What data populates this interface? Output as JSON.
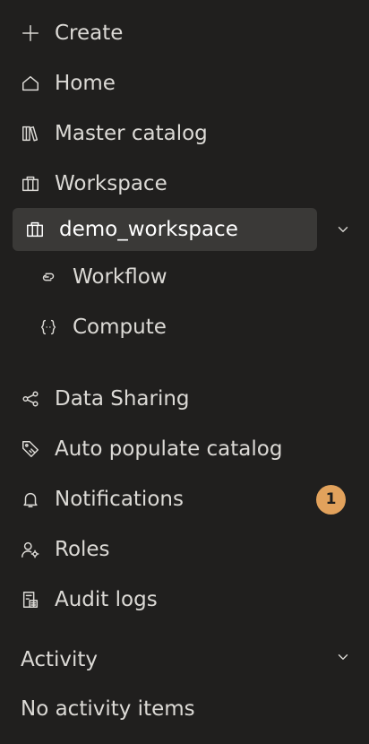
{
  "nav": {
    "create": "Create",
    "home": "Home",
    "master_catalog": "Master catalog",
    "workspace": "Workspace",
    "demo_workspace": "demo_workspace",
    "workflow": "Workflow",
    "compute": "Compute",
    "data_sharing": "Data Sharing",
    "auto_populate_catalog": "Auto populate catalog",
    "notifications": "Notifications",
    "notifications_count": "1",
    "roles": "Roles",
    "audit_logs": "Audit logs"
  },
  "activity": {
    "title": "Activity",
    "empty": "No activity items"
  },
  "colors": {
    "background": "#201f1e",
    "selected_background": "#3a3937",
    "text": "#dcdad6",
    "badge": "#e2a25c"
  }
}
